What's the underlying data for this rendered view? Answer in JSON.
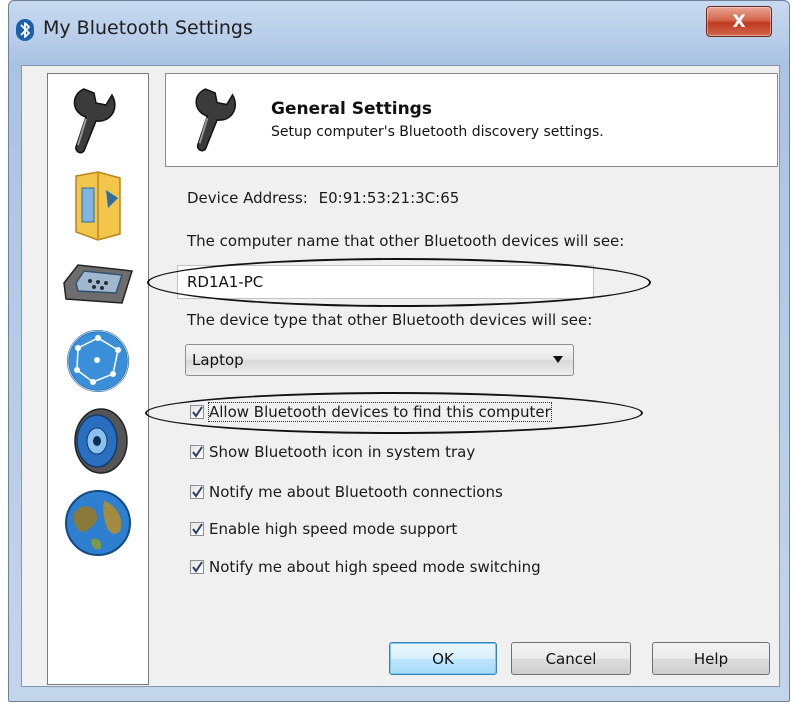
{
  "window": {
    "title": "My Bluetooth Settings",
    "close_label": "X"
  },
  "sidebar": {
    "items": [
      {
        "icon": "wrench-icon"
      },
      {
        "icon": "folder-icon"
      },
      {
        "icon": "serial-port-icon"
      },
      {
        "icon": "network-globe-icon"
      },
      {
        "icon": "speaker-icon"
      },
      {
        "icon": "earth-globe-icon"
      }
    ]
  },
  "header": {
    "title": "General Settings",
    "subtitle": "Setup computer's Bluetooth discovery settings."
  },
  "device": {
    "address_label": "Device Address:",
    "address_value": "E0:91:53:21:3C:65",
    "name_label": "The computer name that other Bluetooth devices will see:",
    "name_value": "RD1A1-PC",
    "type_label": "The device type that other Bluetooth devices will see:",
    "type_value": "Laptop"
  },
  "options": [
    {
      "label": "Allow Bluetooth devices to find this computer",
      "checked": true
    },
    {
      "label": "Show Bluetooth icon in system tray",
      "checked": true
    },
    {
      "label": "Notify me about Bluetooth connections",
      "checked": true
    },
    {
      "label": "Enable high speed mode support",
      "checked": true
    },
    {
      "label": "Notify me about high speed mode switching",
      "checked": true
    }
  ],
  "buttons": {
    "ok": "OK",
    "cancel": "Cancel",
    "help": "Help"
  }
}
